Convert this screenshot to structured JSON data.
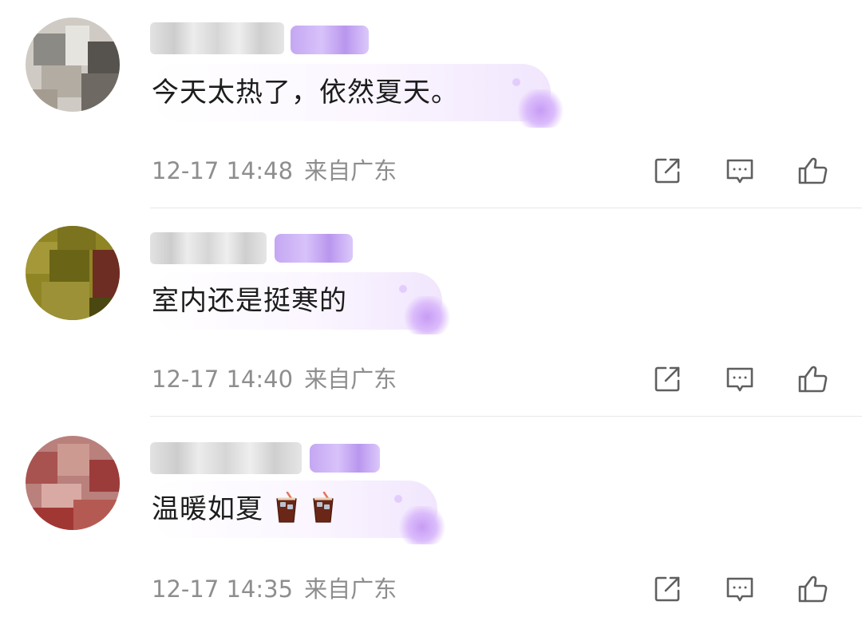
{
  "comments": [
    {
      "text": "今天太热了，依然夏天。",
      "time": "12-17 14:48",
      "location": "来自广东",
      "emoji": []
    },
    {
      "text": "室内还是挺寒的",
      "time": "12-17 14:40",
      "location": "来自广东",
      "emoji": []
    },
    {
      "text": "温暖如夏",
      "time": "12-17 14:35",
      "location": "来自广东",
      "emoji": [
        "iced-drink-icon",
        "iced-drink-icon"
      ]
    }
  ],
  "icons": {
    "share": "share-icon",
    "reply": "comment-icon",
    "like": "thumbs-up-icon"
  },
  "colors": {
    "meta_text": "#8e8e8e",
    "icon": "#5f5f5f",
    "badge_purple": "#c4a7f2",
    "divider": "#e8e8e8"
  }
}
